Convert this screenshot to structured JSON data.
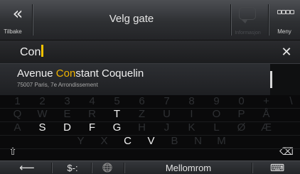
{
  "topbar": {
    "back_label": "Tilbake",
    "back_glyph": "«",
    "title": "Velg gate",
    "info_label": "Informasjon",
    "menu_label": "Meny"
  },
  "search": {
    "value": "Con",
    "clear_glyph": "✕"
  },
  "results": [
    {
      "title_pre": "Avenue ",
      "title_match": "Con",
      "title_post": "stant Coquelin",
      "subtitle": "75007 Paris, 7e Arrondissement"
    }
  ],
  "keyboard": {
    "row_numbers": [
      "1",
      "2",
      "3",
      "4",
      "5",
      "6",
      "7",
      "8",
      "9",
      "0",
      "+",
      "\\"
    ],
    "row_q": [
      "Q",
      "W",
      "E",
      "R",
      "T",
      "Z",
      "U",
      "I",
      "O",
      "P",
      "Å"
    ],
    "row_a": [
      "A",
      "S",
      "D",
      "F",
      "G",
      "H",
      "J",
      "K",
      "L",
      "Ø",
      "Æ"
    ],
    "row_y": [
      "Y",
      "X",
      "C",
      "V",
      "B",
      "N",
      "M"
    ],
    "shift_glyph": "⇧",
    "backspace_glyph": "⌫",
    "bottom": {
      "back_glyph": "⟵",
      "symbols_label": "$-:",
      "globe_glyph": "🌐",
      "space_label": "Mellomrom",
      "keyboard_glyph": "⌨"
    },
    "active_keys": [
      "T",
      "S",
      "D",
      "F",
      "G",
      "C",
      "V"
    ]
  },
  "colors": {
    "match_highlight": "#f0b400",
    "caret": "#f2c200"
  }
}
